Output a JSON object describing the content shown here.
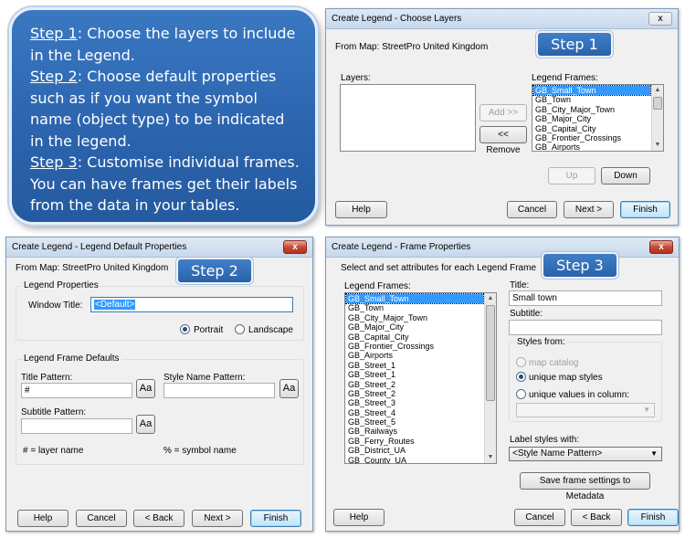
{
  "callout": {
    "lines": [
      {
        "step": "Step 1",
        "text": ": Choose the layers to include"
      },
      {
        "step": "",
        "text": "in the Legend."
      },
      {
        "step": "Step 2",
        "text": ":  Choose default properties"
      },
      {
        "step": "",
        "text": "such as if you want the symbol"
      },
      {
        "step": "",
        "text": "name (object type) to be indicated"
      },
      {
        "step": "",
        "text": "in the legend."
      },
      {
        "step": "Step 3",
        "text": ": Customise individual frames."
      },
      {
        "step": "",
        "text": "You can have frames get their labels"
      },
      {
        "step": "",
        "text": "from the data in your tables."
      }
    ]
  },
  "win1": {
    "title": "Create Legend - Choose Layers",
    "close": "x",
    "from_map": "From Map:  StreetPro United Kingdom",
    "badge": "Step 1",
    "layers_label": "Layers:",
    "legend_frames_label": "Legend Frames:",
    "frames": [
      "GB_Small_Town",
      "GB_Town",
      "GB_City_Major_Town",
      "GB_Major_City",
      "GB_Capital_City",
      "GB_Frontier_Crossings",
      "GB_Airports"
    ],
    "add": "Add >>",
    "remove": "<< Remove",
    "up": "Up",
    "down": "Down",
    "help": "Help",
    "cancel": "Cancel",
    "next": "Next >",
    "finish": "Finish"
  },
  "win2": {
    "title": "Create Legend - Legend Default Properties",
    "close": "x",
    "from_map": "From Map:  StreetPro United Kingdom",
    "badge": "Step 2",
    "legend_properties": "Legend Properties",
    "window_title_label": "Window Title:",
    "window_title_value": "<Default>",
    "portrait": "Portrait",
    "landscape": "Landscape",
    "frame_defaults": "Legend Frame Defaults",
    "title_pattern_label": "Title Pattern:",
    "title_pattern_value": "#",
    "style_name_pattern_label": "Style Name Pattern:",
    "subtitle_pattern_label": "Subtitle Pattern:",
    "aa": "Aa",
    "hash_note": "# = layer name",
    "percent_note": "% = symbol name",
    "help": "Help",
    "cancel": "Cancel",
    "back": "< Back",
    "next": "Next >",
    "finish": "Finish"
  },
  "win3": {
    "title": "Create Legend - Frame Properties",
    "close": "x",
    "instruction": "Select and set attributes for each Legend Frame",
    "badge": "Step 3",
    "legend_frames_label": "Legend Frames:",
    "frames": [
      "GB_Small_Town",
      "GB_Town",
      "GB_City_Major_Town",
      "GB_Major_City",
      "GB_Capital_City",
      "GB_Frontier_Crossings",
      "GB_Airports",
      "GB_Street_1",
      "GB_Street_1",
      "GB_Street_2",
      "GB_Street_2",
      "GB_Street_3",
      "GB_Street_4",
      "GB_Street_5",
      "GB_Railways",
      "GB_Ferry_Routes",
      "GB_District_UA",
      "GB_County_UA"
    ],
    "title_label": "Title:",
    "title_value": "Small town",
    "subtitle_label": "Subtitle:",
    "styles_from": "Styles from:",
    "map_catalog": "map catalog",
    "unique_map_styles": "unique map styles",
    "unique_values": "unique values in column:",
    "label_styles_with": "Label styles with:",
    "label_styles_value": "<Style Name Pattern>",
    "save_metadata": "Save frame settings to Metadata",
    "help": "Help",
    "cancel": "Cancel",
    "back": "< Back",
    "finish": "Finish"
  }
}
